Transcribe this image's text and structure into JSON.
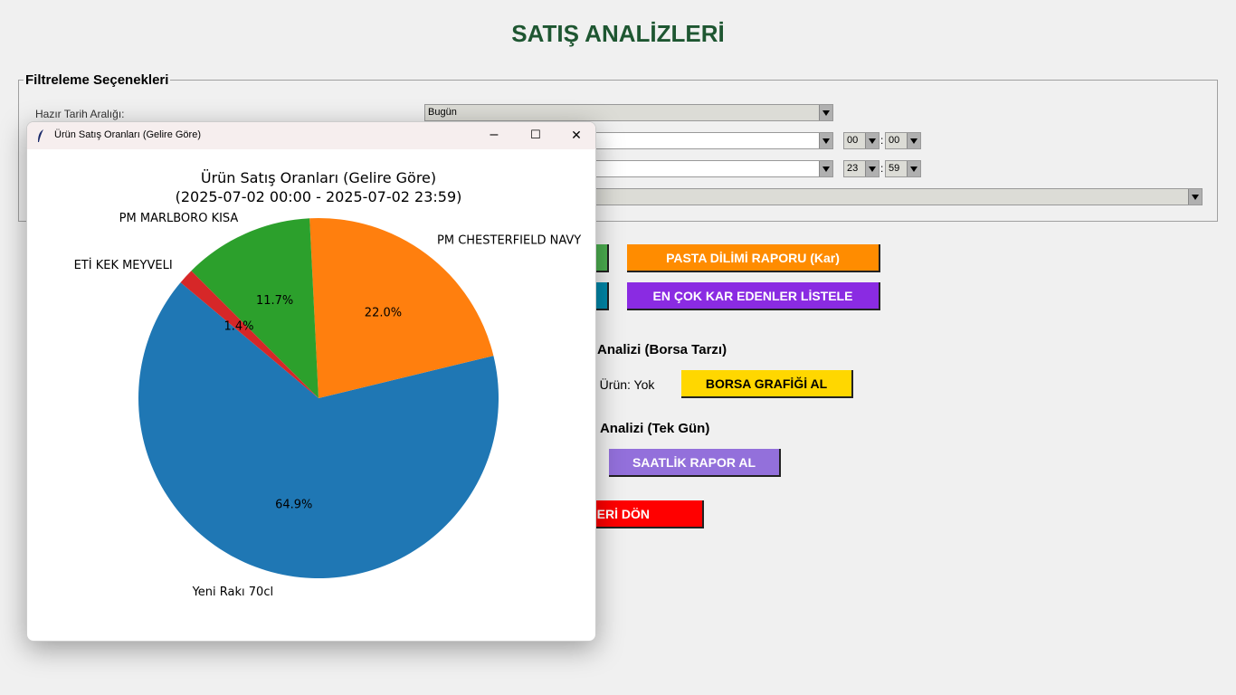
{
  "app": {
    "title": "SATIŞ ANALİZLERİ"
  },
  "filters": {
    "legend": "Filtreleme Seçenekleri",
    "preset_label": "Hazır Tarih Aralığı:",
    "preset_value": "Bugün",
    "start_hour": "00",
    "start_minute": "00",
    "end_hour": "23",
    "end_minute": "59",
    "time_separator": ":"
  },
  "buttons": {
    "pie_profit": "PASTA DİLİMİ RAPORU (Kar)",
    "top_profit": "EN ÇOK KAR EDENLER LİSTELE",
    "stock_chart": "BORSA GRAFİĞİ AL",
    "hourly": "SAATLİK RAPOR AL",
    "back_fragment": "ERİ DÖN",
    "colors": {
      "green": "#4caf50",
      "teal": "#0088aa",
      "orange": "#ff8c00",
      "purple": "#8a2be2",
      "yellow": "#ffd700",
      "lavender": "#9370db",
      "red": "#ff0000"
    }
  },
  "sections": {
    "stock_fragment": "Analizi (Borsa Tarzı)",
    "selected_fragment": "n Ürün: Yok",
    "hourly_fragment": "ş Analizi (Tek Gün)"
  },
  "popup": {
    "window_title": "Ürün Satış Oranları (Gelire Göre)",
    "icon": "feather-icon",
    "minimize": "–",
    "maximize": "☐",
    "close": "✕"
  },
  "chart_data": {
    "type": "pie",
    "title": "Ürün Satış Oranları (Gelire Göre)",
    "subtitle": "(2025-07-02 00:00 - 2025-07-02 23:59)",
    "start_angle": 140,
    "direction": "counterclockwise",
    "slices": [
      {
        "label": "Yeni Rakı 70cl",
        "value": 64.9,
        "pct_label": "64.9%",
        "color": "#1f77b4"
      },
      {
        "label": "PM CHESTERFIELD NAVY",
        "value": 22.0,
        "pct_label": "22.0%",
        "color": "#ff7f0e"
      },
      {
        "label": "PM MARLBORO KISA",
        "value": 11.7,
        "pct_label": "11.7%",
        "color": "#2ca02c"
      },
      {
        "label": "ETİ KEK MEYVELI",
        "value": 1.4,
        "pct_label": "1.4%",
        "color": "#d62728"
      }
    ]
  }
}
